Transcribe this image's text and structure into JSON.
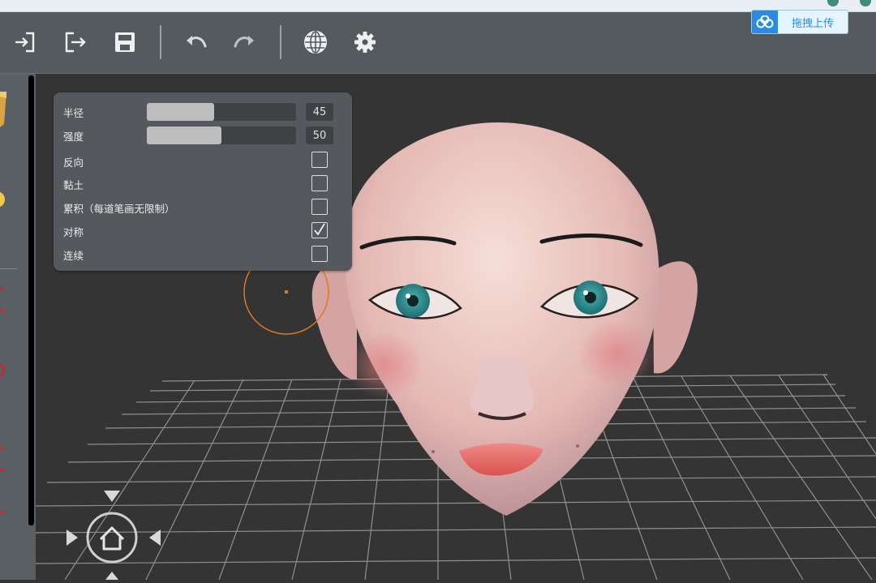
{
  "toolbar": {
    "buttons": [
      {
        "name": "import-icon"
      },
      {
        "name": "export-icon"
      },
      {
        "name": "save-icon"
      },
      {
        "name": "undo-icon"
      },
      {
        "name": "redo-icon"
      },
      {
        "name": "globe-icon"
      },
      {
        "name": "gear-icon"
      }
    ],
    "upload_label": "拖拽上传"
  },
  "panel": {
    "radius": {
      "label": "半径",
      "value": "45",
      "level": 0.45
    },
    "strength": {
      "label": "强度",
      "value": "50",
      "level": 0.5
    },
    "options": [
      {
        "label": "反向",
        "checked": false
      },
      {
        "label": "黏土",
        "checked": false
      },
      {
        "label": "累积（每道笔画无限制）",
        "checked": false
      },
      {
        "label": "对称",
        "checked": true
      },
      {
        "label": "连续",
        "checked": false
      }
    ]
  },
  "colors": {
    "toolbar_bg": "#555a5e",
    "viewport_bg": "#343434",
    "panel_bg": "#55595d",
    "brush_cursor": "#e07820",
    "grid": "#9a9a9a",
    "iris": "#2a8c8f",
    "upload_accent": "#2b8be0"
  }
}
